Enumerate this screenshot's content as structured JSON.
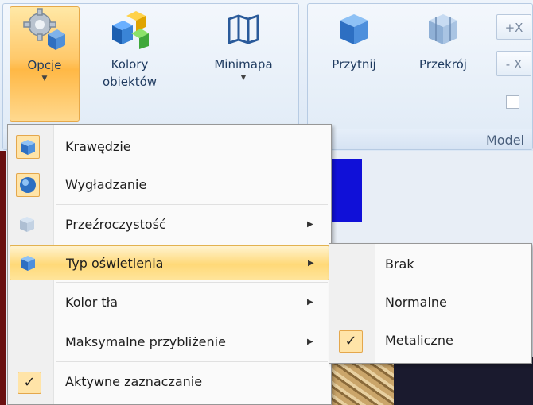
{
  "ribbon": {
    "buttons": {
      "opcje": "Opcje",
      "kolory_line1": "Kolory",
      "kolory_line2": "obiektów",
      "minimapa": "Minimapa",
      "przytnij": "Przytnij",
      "przekroj": "Przekrój"
    },
    "small_buttons": [
      "+X",
      "- X"
    ],
    "group_label": "Model"
  },
  "menu": {
    "items": [
      {
        "label": "Krawędzie",
        "icon": "cube-edges-icon"
      },
      {
        "label": "Wygładzanie",
        "icon": "smooth-sphere-icon"
      },
      {
        "label": "Przeźroczystość",
        "icon": "transparent-cube-icon",
        "has_submenu": true
      },
      {
        "label": "Typ oświetlenia",
        "icon": "lighting-cube-icon",
        "has_submenu": true,
        "highlighted": true
      },
      {
        "label": "Kolor tła",
        "has_submenu": true
      },
      {
        "label": "Maksymalne przybliżenie",
        "has_submenu": true
      },
      {
        "label": "Aktywne zaznaczanie",
        "checked": true
      }
    ]
  },
  "submenu": {
    "items": [
      {
        "label": "Brak"
      },
      {
        "label": "Normalne"
      },
      {
        "label": "Metaliczne",
        "checked": true
      }
    ]
  },
  "colors": {
    "highlight": "#ffd978",
    "accent_border": "#e2b250",
    "ribbon_text": "#1e3a5f"
  }
}
